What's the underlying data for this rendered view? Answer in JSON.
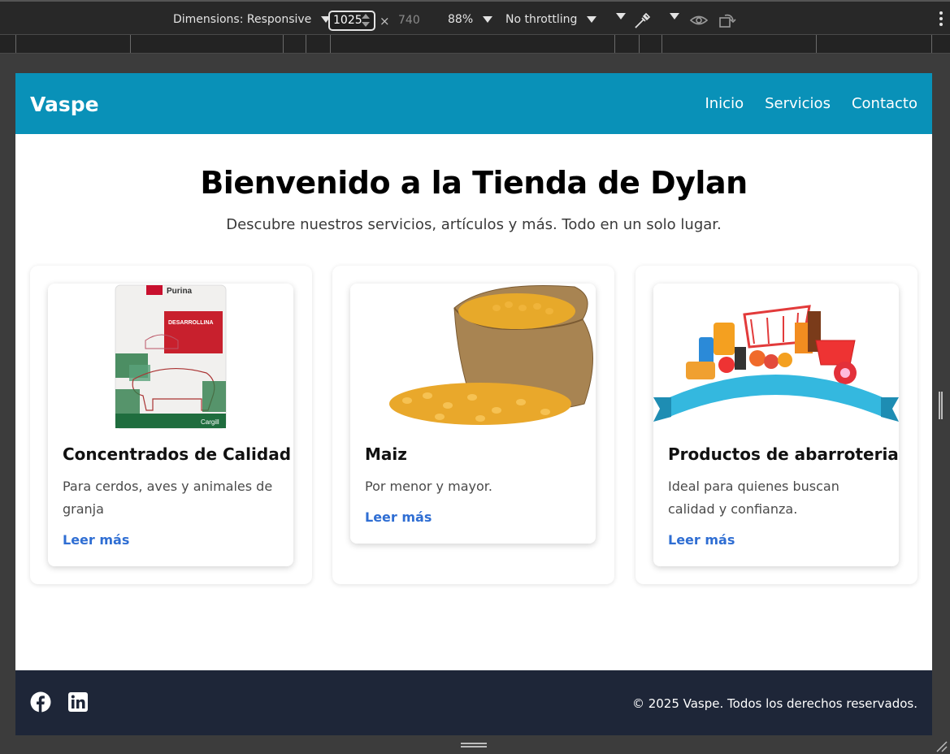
{
  "devtools": {
    "dimensions_label": "Dimensions: Responsive",
    "width_value": "1025",
    "height_value": "740",
    "times_symbol": "×",
    "zoom": "88%",
    "throttling": "No throttling"
  },
  "site": {
    "brand": "Vaspe",
    "nav": [
      "Inicio",
      "Servicios",
      "Contacto"
    ],
    "hero": {
      "title": "Bienvenido a la Tienda de Dylan",
      "subtitle": "Descubre nuestros servicios, artículos y más. Todo en un solo lugar."
    },
    "cards": [
      {
        "title": "Concentrados de Calidad",
        "text": "Para cerdos, aves y animales de granja",
        "link": "Leer más",
        "image": "feed-bag-image",
        "bag_brand": "Purina",
        "bag_product": "DESARROLLINA",
        "bag_maker": "Cargill"
      },
      {
        "title": "Maiz",
        "text": "Por menor y mayor.",
        "link": "Leer más",
        "image": "corn-sack-image"
      },
      {
        "title": "Productos de abarroteria",
        "text": "Ideal para quienes buscan calidad y confianza.",
        "link": "Leer más",
        "image": "groceries-image"
      }
    ],
    "footer": {
      "icons": [
        "facebook-icon",
        "linkedin-icon"
      ],
      "copyright": "© 2025 Vaspe. Todos los derechos reservados."
    },
    "colors": {
      "header": "#0991b8",
      "footer": "#1e2638",
      "link": "#2f6ed3"
    }
  }
}
